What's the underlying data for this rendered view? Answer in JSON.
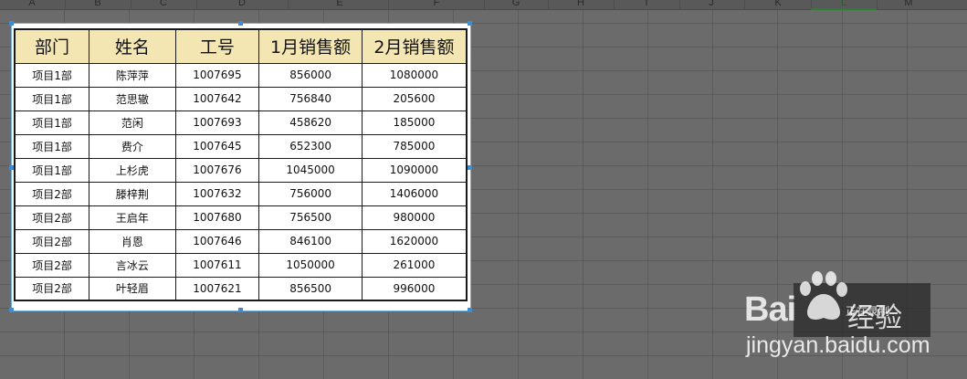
{
  "column_letters": [
    "A",
    "B",
    "C",
    "D",
    "E",
    "F",
    "G",
    "H",
    "I",
    "J",
    "K",
    "L",
    "M"
  ],
  "active_column": "L",
  "table": {
    "headers": [
      "部门",
      "姓名",
      "工号",
      "1月销售额",
      "2月销售额"
    ],
    "rows": [
      [
        "项目1部",
        "陈萍萍",
        "1007695",
        "856000",
        "1080000"
      ],
      [
        "项目1部",
        "范思辙",
        "1007642",
        "756840",
        "205600"
      ],
      [
        "项目1部",
        "范闲",
        "1007693",
        "458620",
        "185000"
      ],
      [
        "项目1部",
        "费介",
        "1007645",
        "652300",
        "785000"
      ],
      [
        "项目1部",
        "上杉虎",
        "1007676",
        "1045000",
        "1090000"
      ],
      [
        "项目2部",
        "滕梓荆",
        "1007632",
        "756000",
        "1406000"
      ],
      [
        "项目2部",
        "王启年",
        "1007680",
        "756500",
        "980000"
      ],
      [
        "项目2部",
        "肖恩",
        "1007646",
        "846100",
        "1620000"
      ],
      [
        "项目2部",
        "言冰云",
        "1007611",
        "1050000",
        "261000"
      ],
      [
        "项目2部",
        "叶轻眉",
        "1007621",
        "856500",
        "996000"
      ]
    ]
  },
  "watermark": {
    "brand": "Bai",
    "brand_cn": "经验",
    "status_text": "正在录制",
    "url": "jingyan.baidu.com"
  },
  "colors": {
    "header_fill": "#f3e6b3",
    "selection": "#3b8ed6",
    "background": "#6b6b6b"
  }
}
